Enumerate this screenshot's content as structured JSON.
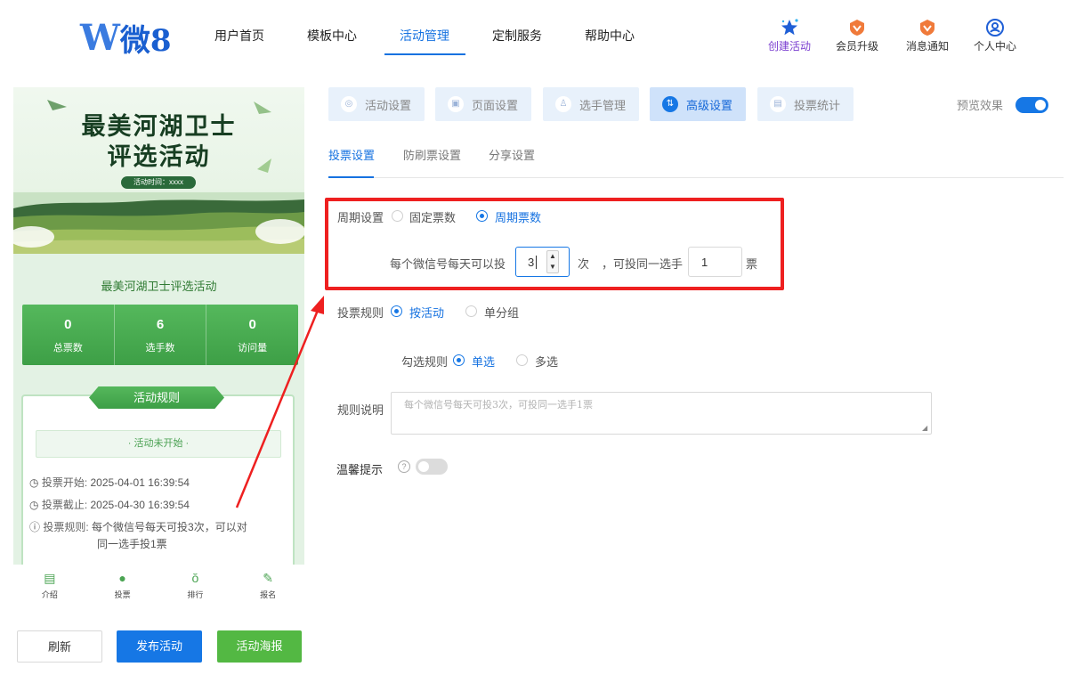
{
  "header": {
    "logo_mark": "W",
    "logo_text": "微8",
    "nav": [
      "用户首页",
      "模板中心",
      "活动管理",
      "定制服务",
      "帮助中心"
    ],
    "active_nav": "活动管理",
    "actions": [
      {
        "label": "创建活动",
        "icon": "star-icon"
      },
      {
        "label": "会员升级",
        "icon": "vip-badge-icon"
      },
      {
        "label": "消息通知",
        "icon": "bell-badge-icon"
      },
      {
        "label": "个人中心",
        "icon": "user-icon"
      }
    ]
  },
  "preview": {
    "banner_title_line1": "最美河湖卫士",
    "banner_title_line2": "评选活动",
    "banner_time": "活动时间：xxxx",
    "activity_name": "最美河湖卫士评选活动",
    "stats": [
      {
        "value": "0",
        "label": "总票数"
      },
      {
        "value": "6",
        "label": "选手数"
      },
      {
        "value": "0",
        "label": "访问量"
      }
    ],
    "rules_title": "活动规则",
    "status_text": "· 活动未开始 ·",
    "vote_start_label": "投票开始:",
    "vote_start": "2025-04-01 16:39:54",
    "vote_end_label": "投票截止:",
    "vote_end": "2025-04-30 16:39:54",
    "vote_rule_label": "投票规则:",
    "vote_rule_line1": "每个微信号每天可投3次，可以对",
    "vote_rule_line2": "同一选手投1票",
    "tabs": [
      {
        "label": "介绍",
        "icon": "intro-icon"
      },
      {
        "label": "投票",
        "icon": "vote-icon"
      },
      {
        "label": "排行",
        "icon": "medal-icon"
      },
      {
        "label": "报名",
        "icon": "signup-icon"
      }
    ]
  },
  "bottom_buttons": {
    "refresh": "刷新",
    "publish": "发布活动",
    "poster": "活动海报"
  },
  "panel_tabs": [
    {
      "label": "活动设置",
      "icon": "settings-icon"
    },
    {
      "label": "页面设置",
      "icon": "page-icon"
    },
    {
      "label": "选手管理",
      "icon": "contestant-icon"
    },
    {
      "label": "高级设置",
      "icon": "advanced-icon"
    },
    {
      "label": "投票统计",
      "icon": "stats-icon"
    }
  ],
  "active_panel_tab": "高级设置",
  "preview_toggle": {
    "label": "预览效果",
    "on": true
  },
  "sub_tabs": [
    "投票设置",
    "防刷票设置",
    "分享设置"
  ],
  "active_sub_tab": "投票设置",
  "form": {
    "cycle_label": "周期设置",
    "cycle_options": [
      "固定票数",
      "周期票数"
    ],
    "cycle_selected": "周期票数",
    "per_day_prefix": "每个微信号每天可以投",
    "per_day_value": "3",
    "per_day_unit": "次",
    "same_player_prefix": "，可投同一选手",
    "same_player_value": "1",
    "same_player_unit": "票",
    "vote_rule_label": "投票规则",
    "vote_rule_options": [
      "按活动",
      "单分组"
    ],
    "vote_rule_selected": "按活动",
    "check_rule_label": "勾选规则",
    "check_rule_options": [
      "单选",
      "多选"
    ],
    "check_rule_selected": "单选",
    "rule_desc_label": "规则说明",
    "rule_desc_placeholder": "每个微信号每天可投3次，可投同一选手1票",
    "tip_label": "温馨提示",
    "tip_on": false
  },
  "colors": {
    "primary": "#1677e5",
    "green": "#53b843",
    "highlight": "#ee2020"
  }
}
